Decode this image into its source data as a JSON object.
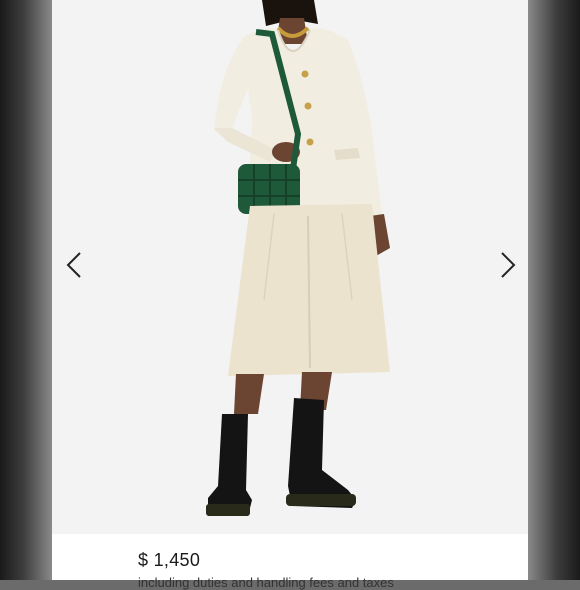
{
  "product": {
    "image_alt": "Model in cream jacket with green woven bag, cream culottes and black boots",
    "price": "$ 1,450",
    "subtitle": "including duties and handling fees and taxes"
  },
  "carousel": {
    "prev_icon": "chevron-left-icon",
    "next_icon": "chevron-right-icon"
  },
  "colors": {
    "stage_bg": "#f3f3f3",
    "jacket": "#f2ede1",
    "culottes": "#ece3cf",
    "bag": "#1e5a3a",
    "boots": "#141414",
    "skin": "#6b4532"
  }
}
